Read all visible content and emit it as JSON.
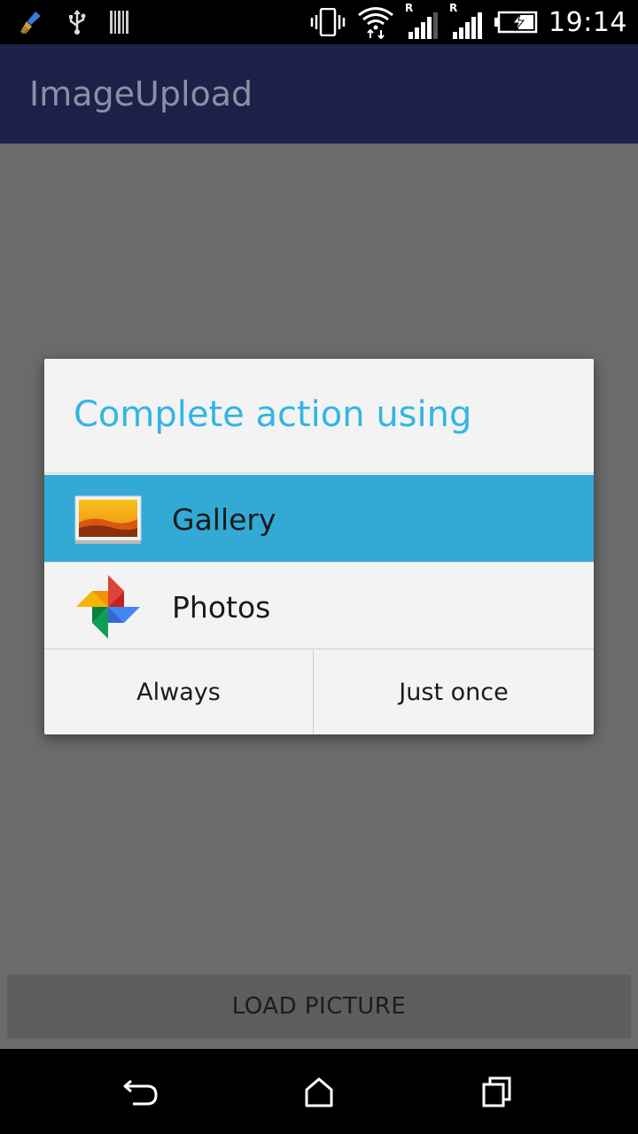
{
  "status_bar": {
    "time": "19:14",
    "roaming_label": "R",
    "icons": [
      "cleaner-icon",
      "usb-icon",
      "barcode-icon",
      "vibrate-icon",
      "wifi-icon",
      "signal-icon",
      "signal-icon",
      "battery-charging-icon"
    ]
  },
  "app_bar": {
    "title": "ImageUpload"
  },
  "dialog": {
    "title": "Complete action using",
    "options": [
      {
        "label": "Gallery",
        "icon": "gallery-icon",
        "selected": true
      },
      {
        "label": "Photos",
        "icon": "photos-pinwheel-icon",
        "selected": false
      }
    ],
    "buttons": {
      "always": "Always",
      "just_once": "Just once"
    }
  },
  "main": {
    "load_button_label": "LOAD PICTURE"
  },
  "nav_bar": {
    "icons": [
      "back-icon",
      "home-icon",
      "recent-apps-icon"
    ]
  },
  "colors": {
    "accent": "#33b5e5",
    "selected_row": "#33aad6",
    "app_bar": "#1b2149"
  }
}
